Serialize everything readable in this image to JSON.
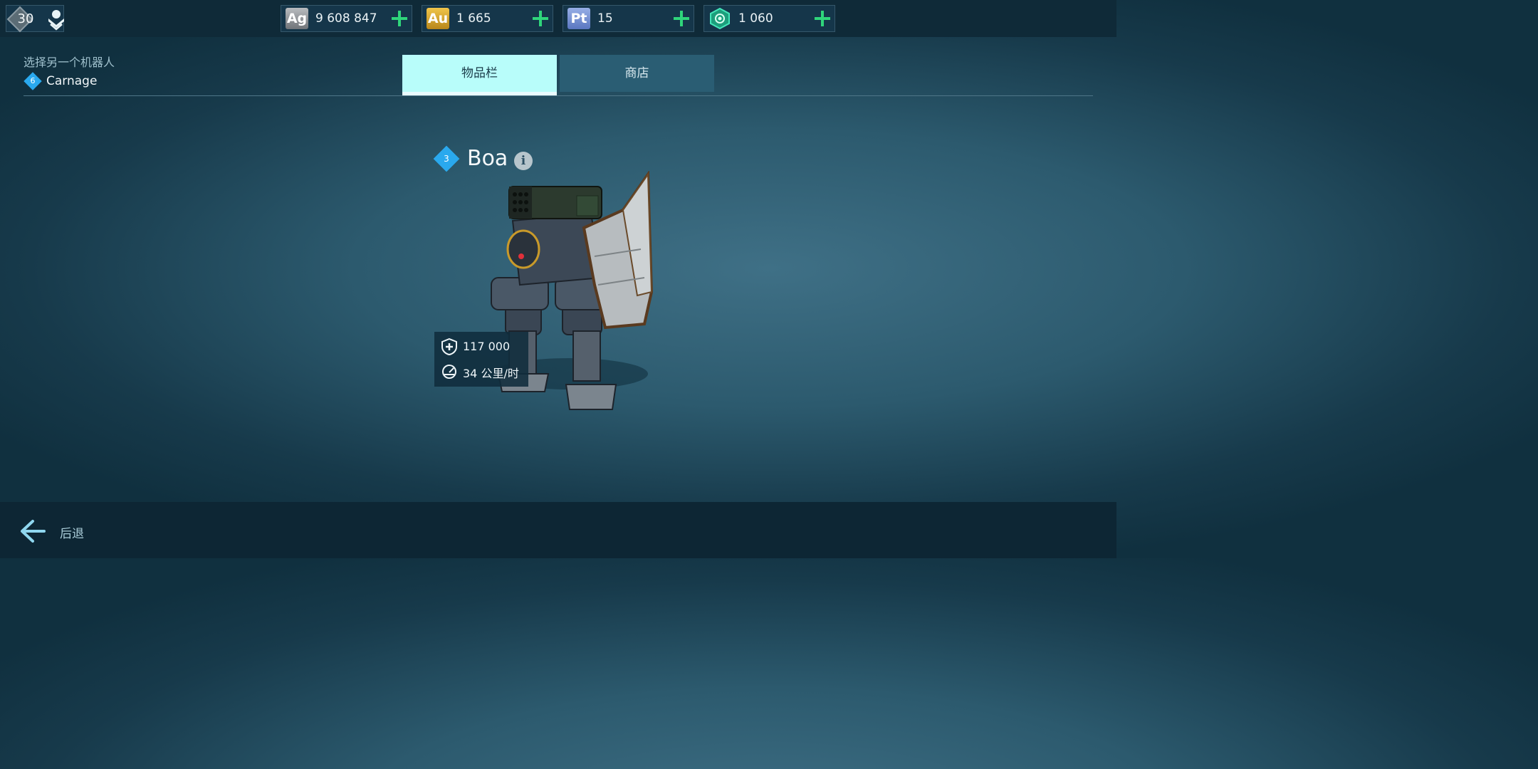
{
  "player": {
    "level": "30",
    "rank_icon": "rank-chevron-icon"
  },
  "currencies": [
    {
      "code": "Ag",
      "value": "9 608 847",
      "color": "#8c8f93"
    },
    {
      "code": "Au",
      "value": "1 665",
      "color": "#d1a324"
    },
    {
      "code": "Pt",
      "value": "15",
      "color": "#6d8ed8"
    },
    {
      "code": "",
      "value": "1 060",
      "icon": "key-hexagon-icon",
      "color": "#2ed3a4"
    }
  ],
  "selector": {
    "title": "选择另一个机器人",
    "robot_level": "6",
    "robot_name": "Carnage"
  },
  "tabs": [
    {
      "label": "物品栏",
      "active": true
    },
    {
      "label": "商店",
      "active": false
    }
  ],
  "robot": {
    "level": "3",
    "name": "Boa"
  },
  "stats": {
    "durability": "117 000",
    "speed": "34 公里/时"
  },
  "footer": {
    "back_label": "后退"
  },
  "colors": {
    "accent": "#b8fdfa",
    "plus": "#2fd57b",
    "level_badge": "#2aa9ee"
  }
}
